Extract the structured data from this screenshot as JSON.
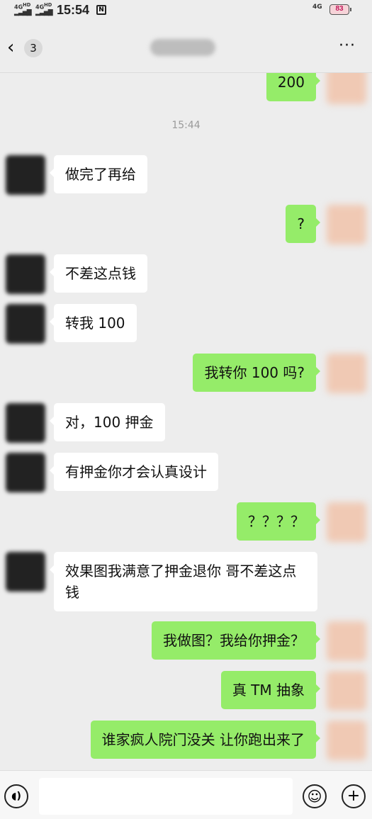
{
  "status_bar": {
    "signal1": "4G",
    "signal1_sup": "HD",
    "signal2": "4G",
    "signal2_sup": "HD",
    "time": "15:54",
    "network": "4G",
    "battery": "83",
    "icons": [
      "signal-icon",
      "no-notification-icon",
      "battery-icon"
    ]
  },
  "header": {
    "back_glyph": "‹",
    "unread_count": "3",
    "more_glyph": "···"
  },
  "chat": {
    "top_partial_message": "200",
    "timestamp": "15:44",
    "messages": [
      {
        "side": "left",
        "text": "做完了再给"
      },
      {
        "side": "right",
        "text": "?"
      },
      {
        "side": "left",
        "text": "不差这点钱"
      },
      {
        "side": "left",
        "text": "转我 100"
      },
      {
        "side": "right",
        "text": "我转你 100 吗?"
      },
      {
        "side": "left",
        "text": "对，100 押金"
      },
      {
        "side": "left",
        "text": "有押金你才会认真设计"
      },
      {
        "side": "right",
        "text": "？？？？"
      },
      {
        "side": "left",
        "text": "效果图我满意了押金退你 哥不差这点钱"
      },
      {
        "side": "right",
        "text": "我做图？我给你押金？"
      },
      {
        "side": "right",
        "text": "真 TM 抽象"
      },
      {
        "side": "right",
        "text": "谁家疯人院门没关 让你跑出来了"
      }
    ]
  },
  "input_bar": {
    "voice_glyph": "◖)",
    "emoji_glyph": "☺",
    "plus_glyph": "+"
  }
}
